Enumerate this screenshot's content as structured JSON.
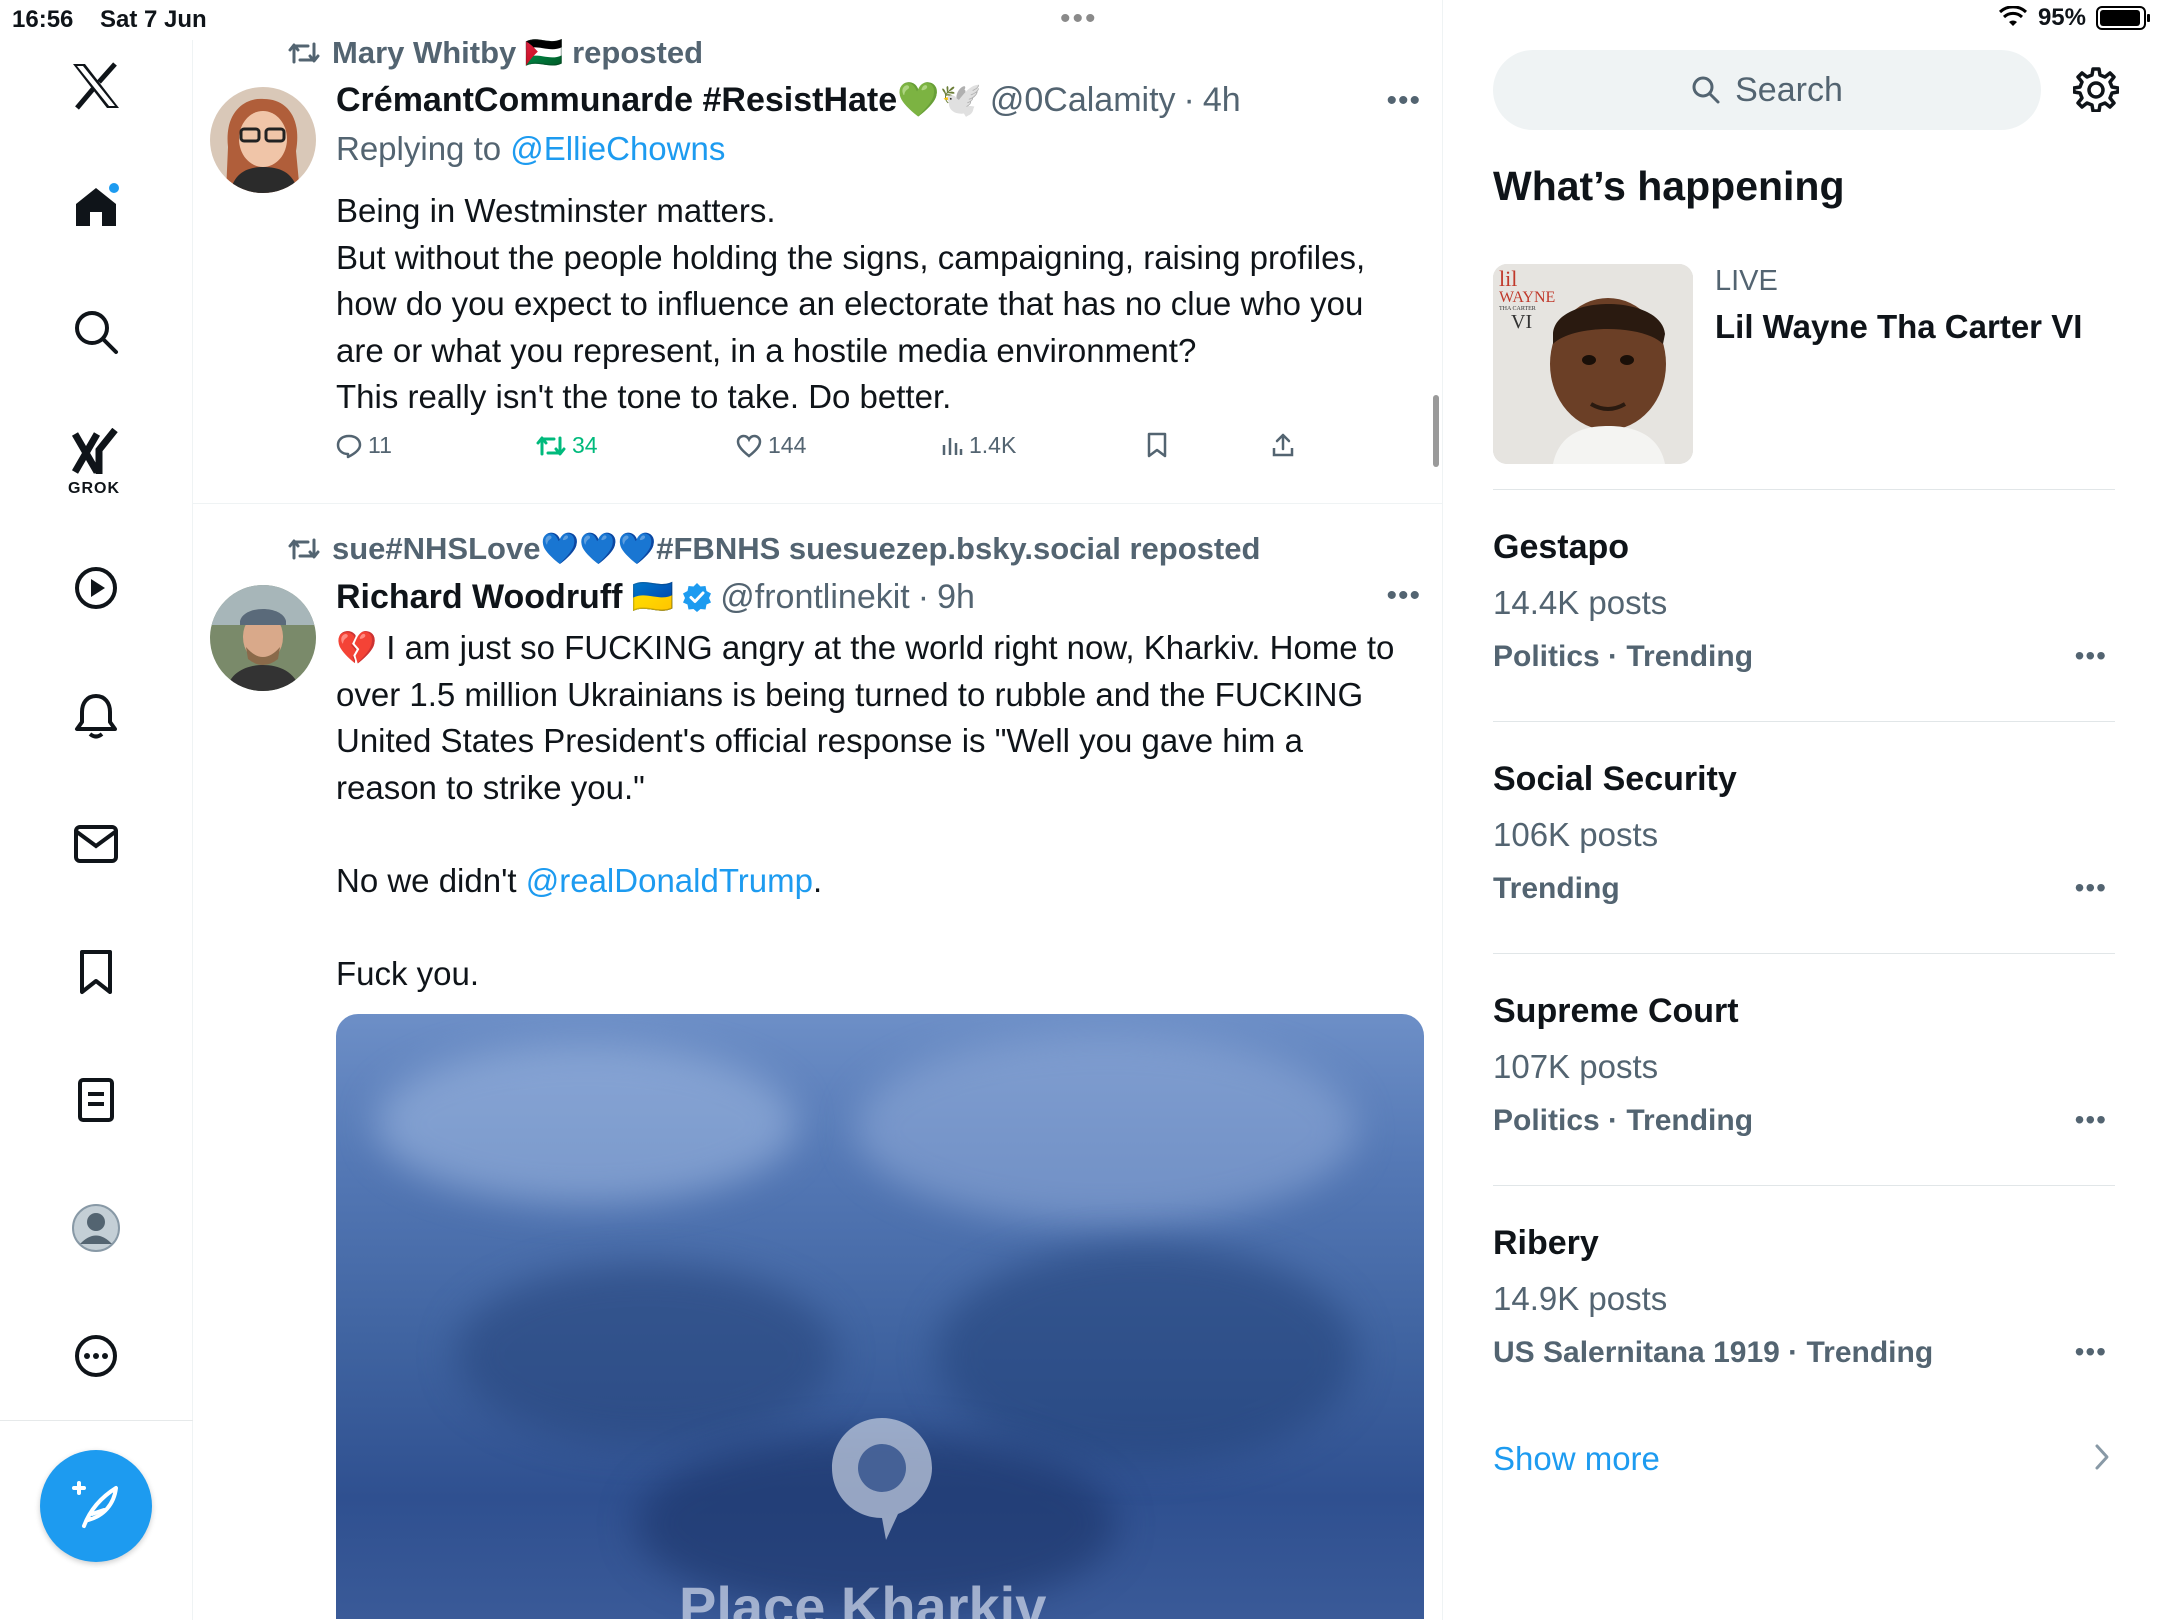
{
  "status_bar": {
    "time": "16:56",
    "date": "Sat 7 Jun",
    "battery": "95%",
    "battery_level": 0.95
  },
  "nav": {
    "grok_label": "GROK",
    "items": [
      "x-logo",
      "home",
      "explore",
      "grok",
      "video",
      "notifications",
      "messages",
      "bookmarks",
      "lists",
      "profile",
      "more"
    ]
  },
  "tweets": [
    {
      "repost_by": "Mary Whitby 🇵🇸 reposted",
      "author": "CrémantCommunarde #ResistHate💚🕊️",
      "handle": "@0Calamity",
      "time": "4h",
      "replying_prefix": "Replying to ",
      "replying_to": "@EllieChowns",
      "lines": [
        "Being in Westminster matters.",
        "But without the people holding the signs, campaigning, raising profiles,",
        "how do you expect to influence an electorate that has no clue who you",
        "are or what you represent, in a hostile media environment?",
        "This really isn't the tone to take. Do better."
      ],
      "replies": "11",
      "reposts": "34",
      "likes": "144",
      "views": "1.4K"
    },
    {
      "repost_by": "sue#NHSLove💙💙💙#FBNHS suesuezep.bsky.social reposted",
      "author": "Richard Woodruff 🇺🇦",
      "handle": "@frontlinekit",
      "time": "9h",
      "lines": [
        "💔 I am just so FUCKING angry at the world right now, Kharkiv. Home to",
        "over 1.5 million Ukrainians is being turned to rubble and the FUCKING",
        "United States President's official response is \"Well you gave him a",
        "reason to strike you.\""
      ],
      "line_mention_prefix": "No we didn't ",
      "line_mention": "@realDonaldTrump",
      "line_mention_suffix": ".",
      "closing": "Fuck you.",
      "media_caption": "Place Kharkiv"
    }
  ],
  "sidebar": {
    "search_placeholder": "Search",
    "title": "What’s happening",
    "live": {
      "label": "LIVE",
      "title": "Lil Wayne Tha Carter VI",
      "cover_lines": [
        "lil",
        "WAYNE",
        "THA CARTER",
        "VI"
      ]
    },
    "trends": [
      {
        "name": "Gestapo",
        "posts": "14.4K posts",
        "meta": "Politics · Trending"
      },
      {
        "name": "Social Security",
        "posts": "106K posts",
        "meta": "Trending"
      },
      {
        "name": "Supreme Court",
        "posts": "107K posts",
        "meta": "Politics · Trending"
      },
      {
        "name": "Ribery",
        "posts": "14.9K posts",
        "meta": "US Salernitana 1919 · Trending"
      }
    ],
    "show_more": "Show more"
  },
  "colors": {
    "accent": "#1d9bf0",
    "repost_green": "#00ba7c",
    "muted": "#536471"
  }
}
